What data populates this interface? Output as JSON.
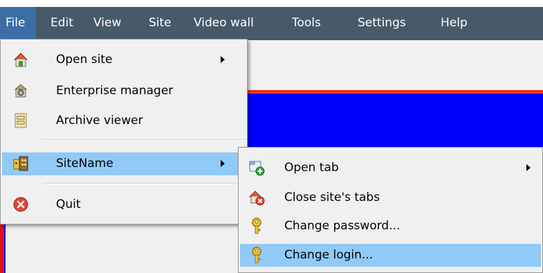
{
  "menubar": {
    "items": [
      "File",
      "Edit",
      "View",
      "Site",
      "Video wall",
      "Tools",
      "Settings",
      "Help"
    ]
  },
  "file_menu": {
    "open_site": "Open site",
    "enterprise_manager": "Enterprise manager",
    "archive_viewer": "Archive viewer",
    "site_name": "SiteName",
    "quit": "Quit"
  },
  "site_menu": {
    "open_tab": "Open tab",
    "close_tabs": "Close site's tabs",
    "change_password": "Change password...",
    "change_login": "Change login..."
  },
  "colors": {
    "menubar": "#475a6a",
    "menubar_active": "#3b6ea5",
    "highlight": "#91c9f7",
    "background_blue": "#0000ff"
  },
  "icons": {
    "open_site": "house-icon",
    "enterprise_manager": "enterprise-icon",
    "archive_viewer": "archive-icon",
    "site_name": "site-icon",
    "quit": "quit-icon",
    "open_tab": "open-tab-icon",
    "close_tabs": "close-tabs-icon",
    "change_password": "key-icon",
    "change_login": "key-icon"
  }
}
